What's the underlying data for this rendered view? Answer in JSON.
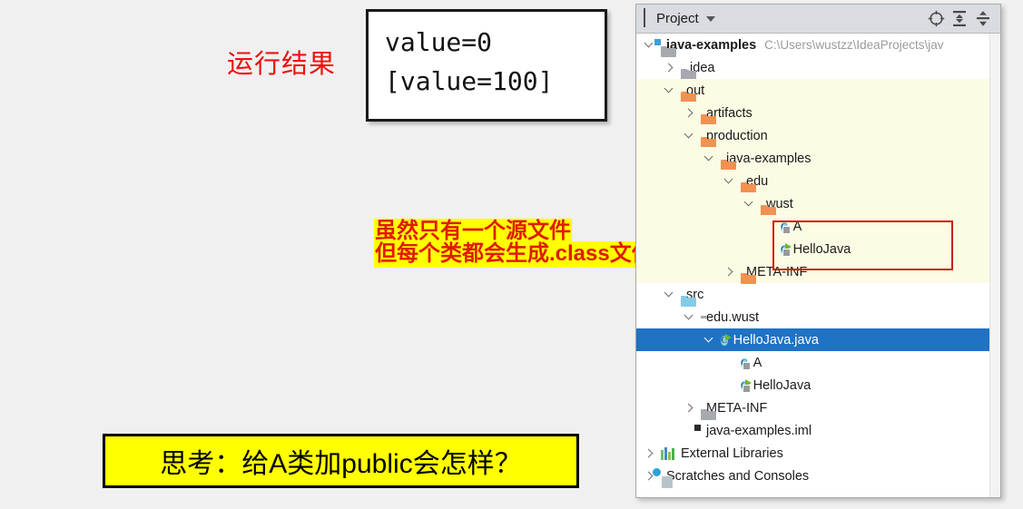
{
  "annotations": {
    "run_result_label": "运行结果",
    "output_box": {
      "line1": "value=0",
      "line2": "[value=100]"
    },
    "class_note": {
      "line1": "虽然只有一个源文件",
      "line2": "但每个类都会生成.class文件",
      "arrow": "right-arrow-icon"
    },
    "question_box": {
      "text": "思考：给A类加public会怎样？"
    },
    "colors": {
      "highlight_yellow": "#ffff00",
      "note_red": "#e01b00",
      "label_red": "#ee1111",
      "arrow_red": "#e8380d",
      "selection_blue": "#1f72c4",
      "excluded_cream": "#fcfbe4"
    }
  },
  "project_panel": {
    "header": {
      "title": "Project",
      "dropdown_icon": "chevron-down-icon",
      "actions": [
        {
          "name": "select-opened-file-icon",
          "glyph": "⊕"
        },
        {
          "name": "expand-all-icon",
          "glyph": "⇕"
        },
        {
          "name": "collapse-all-icon",
          "glyph": "⇡⇣"
        }
      ]
    },
    "tree": [
      {
        "label": "java-examples",
        "hint": "C:\\Users\\wustzz\\IdeaProjects\\jav",
        "indent": 0,
        "twisty": "down",
        "icon": "module-icon",
        "bold": true,
        "style": "normal"
      },
      {
        "label": ".idea",
        "hint": "",
        "indent": 1,
        "twisty": "right",
        "icon": "folder-gray-icon",
        "bold": false,
        "style": "normal"
      },
      {
        "label": "out",
        "hint": "",
        "indent": 1,
        "twisty": "down",
        "icon": "folder-orange-icon",
        "bold": false,
        "style": "excluded"
      },
      {
        "label": "artifacts",
        "hint": "",
        "indent": 2,
        "twisty": "right",
        "icon": "folder-orange-icon",
        "bold": false,
        "style": "excluded"
      },
      {
        "label": "production",
        "hint": "",
        "indent": 2,
        "twisty": "down",
        "icon": "folder-orange-icon",
        "bold": false,
        "style": "excluded"
      },
      {
        "label": "java-examples",
        "hint": "",
        "indent": 3,
        "twisty": "down",
        "icon": "folder-orange-icon",
        "bold": false,
        "style": "excluded"
      },
      {
        "label": "edu",
        "hint": "",
        "indent": 4,
        "twisty": "down",
        "icon": "folder-orange-icon",
        "bold": false,
        "style": "excluded"
      },
      {
        "label": "wust",
        "hint": "",
        "indent": 5,
        "twisty": "down",
        "icon": "folder-orange-icon",
        "bold": false,
        "style": "excluded"
      },
      {
        "label": "A",
        "hint": "",
        "indent": 6,
        "twisty": "none",
        "icon": "class-icon",
        "bold": false,
        "style": "excluded"
      },
      {
        "label": "HelloJava",
        "hint": "",
        "indent": 6,
        "twisty": "none",
        "icon": "class-runnable-icon",
        "bold": false,
        "style": "excluded"
      },
      {
        "label": "META-INF",
        "hint": "",
        "indent": 4,
        "twisty": "right",
        "icon": "folder-orange-icon",
        "bold": false,
        "style": "excluded"
      },
      {
        "label": "src",
        "hint": "",
        "indent": 1,
        "twisty": "down",
        "icon": "folder-blue-icon",
        "bold": false,
        "style": "normal"
      },
      {
        "label": "edu.wust",
        "hint": "",
        "indent": 2,
        "twisty": "down",
        "icon": "package-icon",
        "bold": false,
        "style": "normal"
      },
      {
        "label": "HelloJava.java",
        "hint": "",
        "indent": 3,
        "twisty": "down",
        "icon": "java-file-icon",
        "bold": false,
        "style": "selected"
      },
      {
        "label": "A",
        "hint": "",
        "indent": 4,
        "twisty": "none",
        "icon": "class-icon",
        "bold": false,
        "style": "normal"
      },
      {
        "label": "HelloJava",
        "hint": "",
        "indent": 4,
        "twisty": "none",
        "icon": "class-runnable-icon",
        "bold": false,
        "style": "normal"
      },
      {
        "label": "META-INF",
        "hint": "",
        "indent": 2,
        "twisty": "right",
        "icon": "folder-gray-icon",
        "bold": false,
        "style": "normal"
      },
      {
        "label": "java-examples.iml",
        "hint": "",
        "indent": 2,
        "twisty": "none",
        "icon": "iml-file-icon",
        "bold": false,
        "style": "normal"
      },
      {
        "label": "External Libraries",
        "hint": "",
        "indent": 0,
        "twisty": "right",
        "icon": "libraries-icon",
        "bold": false,
        "style": "normal"
      },
      {
        "label": "Scratches and Consoles",
        "hint": "",
        "indent": 0,
        "twisty": "right",
        "icon": "scratches-icon",
        "bold": false,
        "style": "normal"
      }
    ]
  }
}
